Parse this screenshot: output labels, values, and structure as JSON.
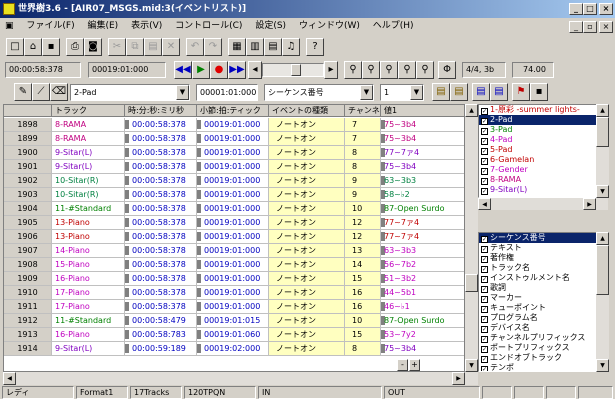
{
  "window": {
    "title": "世界樹3.6 - [AIR07_MSGS.mid:3(イベントリスト)]"
  },
  "menu": [
    "ファイル(F)",
    "編集(E)",
    "表示(V)",
    "コントロール(C)",
    "設定(S)",
    "ウィンドウ(W)",
    "ヘルプ(H)"
  ],
  "transport": {
    "time": "00:00:58:378",
    "measure": "00019:01:000",
    "beat": "4/4, 3b",
    "tempo": "74.00"
  },
  "filter": {
    "track": "2-Pad",
    "position": "00001:01:000",
    "event_type": "シーケンス番号",
    "channel": "1"
  },
  "columns": [
    "トラック",
    "時:分:秒:ミリ秒",
    "小節:拍:ティック",
    "イベントの種類",
    "チャンネル",
    "値1"
  ],
  "rows": [
    {
      "n": "1898",
      "track": "8-RAMA",
      "time": "00:00:58:378",
      "mbt": "00019:01:000",
      "type": "ノートオン",
      "ch": "7",
      "v": "75~3b4",
      "c": "#c00080"
    },
    {
      "n": "1899",
      "track": "8-RAMA",
      "time": "00:00:58:378",
      "mbt": "00019:01:000",
      "type": "ノートオン",
      "ch": "7",
      "v": "75~3b4",
      "c": "#c00080"
    },
    {
      "n": "1900",
      "track": "9-Sitar(L)",
      "time": "00:00:58:378",
      "mbt": "00019:01:000",
      "type": "ノートオン",
      "ch": "8",
      "v": "77~7ァ4",
      "c": "#8000c0"
    },
    {
      "n": "1901",
      "track": "9-Sitar(L)",
      "time": "00:00:58:378",
      "mbt": "00019:01:000",
      "type": "ノートオン",
      "ch": "8",
      "v": "75~3b4",
      "c": "#8000c0"
    },
    {
      "n": "1902",
      "track": "10-Sitar(R)",
      "time": "00:00:58:378",
      "mbt": "00019:01:000",
      "type": "ノートオン",
      "ch": "9",
      "v": "63~3b3",
      "c": "#008040"
    },
    {
      "n": "1903",
      "track": "10-Sitar(R)",
      "time": "00:00:58:378",
      "mbt": "00019:01:000",
      "type": "ノートオン",
      "ch": "9",
      "v": "58~♭2",
      "c": "#008040"
    },
    {
      "n": "1904",
      "track": "11-#Standard",
      "time": "00:00:58:378",
      "mbt": "00019:01:000",
      "type": "ノートオン",
      "ch": "10",
      "v": "87-Open Surdo",
      "c": "#008000"
    },
    {
      "n": "1905",
      "track": "13-Piano",
      "time": "00:00:58:378",
      "mbt": "00019:01:000",
      "type": "ノートオン",
      "ch": "12",
      "v": "77~7ァ4",
      "c": "#c00000"
    },
    {
      "n": "1906",
      "track": "13-Piano",
      "time": "00:00:58:378",
      "mbt": "00019:01:000",
      "type": "ノートオン",
      "ch": "12",
      "v": "77~7ァ4",
      "c": "#c00000"
    },
    {
      "n": "1907",
      "track": "14-Piano",
      "time": "00:00:58:378",
      "mbt": "00019:01:000",
      "type": "ノートオン",
      "ch": "13",
      "v": "63~3b3",
      "c": "#c000c0"
    },
    {
      "n": "1908",
      "track": "15-Piano",
      "time": "00:00:58:378",
      "mbt": "00019:01:000",
      "type": "ノートオン",
      "ch": "14",
      "v": "56~7b2",
      "c": "#c000c0"
    },
    {
      "n": "1909",
      "track": "16-Piano",
      "time": "00:00:58:378",
      "mbt": "00019:01:000",
      "type": "ノートオン",
      "ch": "15",
      "v": "51~3b2",
      "c": "#c000c0"
    },
    {
      "n": "1910",
      "track": "17-Piano",
      "time": "00:00:58:378",
      "mbt": "00019:01:000",
      "type": "ノートオン",
      "ch": "16",
      "v": "44~5b1",
      "c": "#c000c0"
    },
    {
      "n": "1911",
      "track": "17-Piano",
      "time": "00:00:58:378",
      "mbt": "00019:01:000",
      "type": "ノートオン",
      "ch": "16",
      "v": "46~♭1",
      "c": "#c000c0"
    },
    {
      "n": "1912",
      "track": "11-#Standard",
      "time": "00:00:58:479",
      "mbt": "00019:01:015",
      "type": "ノートオン",
      "ch": "10",
      "v": "87-Open Surdo",
      "c": "#008000"
    },
    {
      "n": "1913",
      "track": "16-Piano",
      "time": "00:00:58:783",
      "mbt": "00019:01:060",
      "type": "ノートオン",
      "ch": "15",
      "v": "53~7y2",
      "c": "#c000c0"
    },
    {
      "n": "1914",
      "track": "9-Sitar(L)",
      "time": "00:00:59:189",
      "mbt": "00019:02:000",
      "type": "ノートオン",
      "ch": "8",
      "v": "75~3b4",
      "c": "#8000c0"
    }
  ],
  "tracks": [
    {
      "t": "1-原彩 -summer lights-",
      "c": "#c00000"
    },
    {
      "t": "2-Pad",
      "c": "#ffffff",
      "sel": true
    },
    {
      "t": "3-Pad",
      "c": "#008000"
    },
    {
      "t": "4-Pad",
      "c": "#c000c0"
    },
    {
      "t": "5-Pad",
      "c": "#c00000"
    },
    {
      "t": "6-Gamelan",
      "c": "#c00000"
    },
    {
      "t": "7-Gender",
      "c": "#c000c0"
    },
    {
      "t": "8-RAMA",
      "c": "#c00080"
    },
    {
      "t": "9-Sitar(L)",
      "c": "#8000c0"
    }
  ],
  "event_types": [
    {
      "t": "シーケンス番号",
      "sel": true
    },
    {
      "t": "テキスト"
    },
    {
      "t": "著作権"
    },
    {
      "t": "トラック名"
    },
    {
      "t": "インストゥルメント名"
    },
    {
      "t": "歌詞"
    },
    {
      "t": "マーカー"
    },
    {
      "t": "キューポイント"
    },
    {
      "t": "プログラム名"
    },
    {
      "t": "デバイス名"
    },
    {
      "t": "チャンネルプリフィックス"
    },
    {
      "t": "ポートプリフィックス"
    },
    {
      "t": "エンドオブトラック"
    },
    {
      "t": "テンポ"
    },
    {
      "t": "SMPTEオフセット"
    },
    {
      "t": "拍子記号"
    },
    {
      "t": "調性記号"
    },
    {
      "t": "シーケンサ固有のイベント"
    }
  ],
  "status": {
    "ready": "レディ",
    "format": "Format1",
    "tracks": "17Tracks",
    "tpqn": "120TPQN",
    "in": "IN",
    "out": "OUT"
  }
}
